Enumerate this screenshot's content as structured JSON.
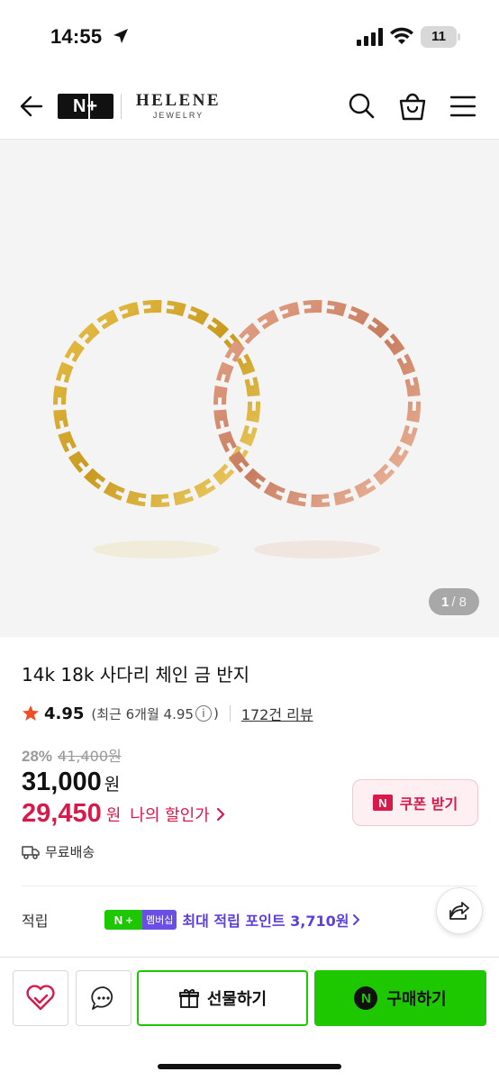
{
  "status_bar": {
    "time": "14:55",
    "battery": "11"
  },
  "header": {
    "logo_badge": "N+",
    "brand_name": "HELENE",
    "brand_sub": "JEWELRY"
  },
  "gallery": {
    "current": "1",
    "total": "/ 8"
  },
  "product": {
    "title": "14k 18k 사다리 체인 금 반지",
    "rating": "4.95",
    "rating_detail": "(최근 6개월 4.95",
    "rating_detail_close": ")",
    "reviews": "172건 리뷰",
    "discount_rate": "28%",
    "original_price": "41,400원",
    "price": "31,000",
    "price_unit": "원",
    "my_price": "29,450",
    "my_price_unit": "원",
    "my_price_label": "나의 할인가",
    "coupon_badge": "N",
    "coupon_label": "쿠폰 받기",
    "shipping": "무료배송"
  },
  "points": {
    "label": "적립",
    "badge_left": "N +",
    "badge_right": "멤버십",
    "text": "최대 적립 포인트 3,710원"
  },
  "bottom_bar": {
    "gift_label": "선물하기",
    "buy_badge": "N",
    "buy_label": "구매하기"
  },
  "colors": {
    "naver_green": "#1ec800",
    "sale_red": "#d8194a",
    "membership_purple": "#5b3fe0",
    "star": "#f04e23"
  }
}
